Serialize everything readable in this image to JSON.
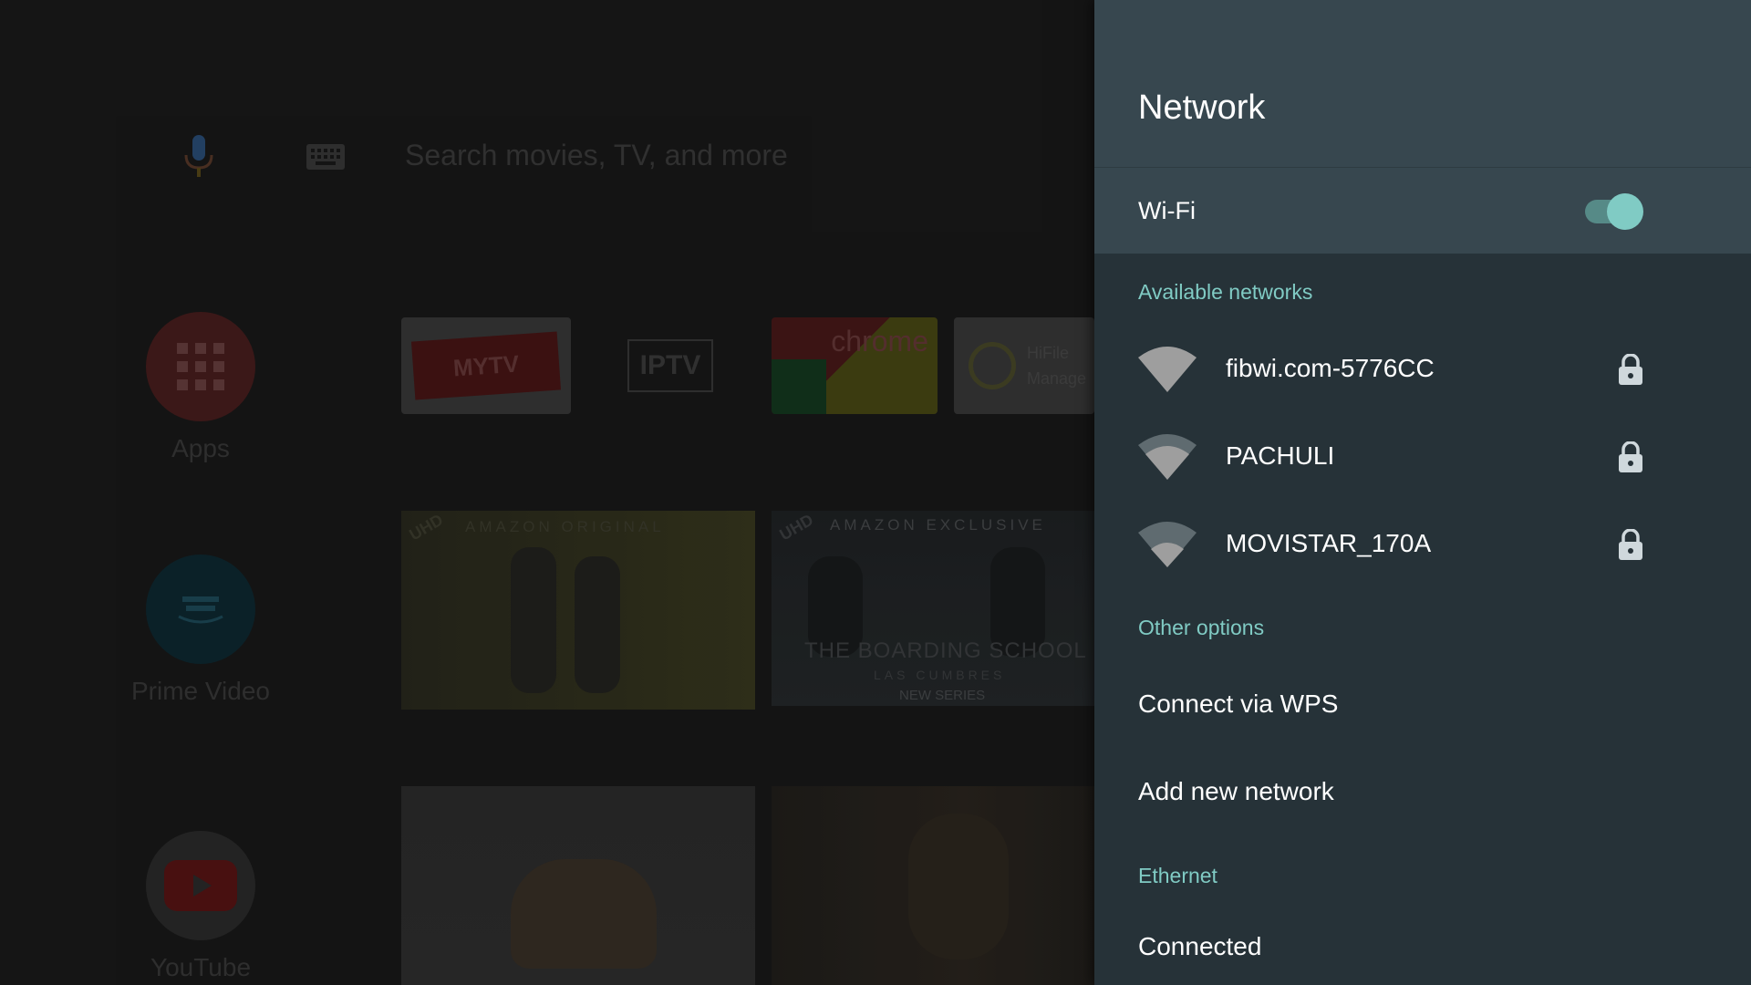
{
  "search": {
    "placeholder": "Search movies, TV, and more"
  },
  "home_nav": [
    {
      "label": "Apps"
    },
    {
      "label": "Prime Video"
    },
    {
      "label": "YouTube"
    }
  ],
  "favorite_apps": [
    {
      "name": "MYTV"
    },
    {
      "name": "IPTV"
    },
    {
      "name": "chrome"
    },
    {
      "name": "HiFile Manage"
    }
  ],
  "content_cards": [
    {
      "badge": "UHD",
      "overline": "AMAZON ORIGINAL",
      "caption": ""
    },
    {
      "badge": "UHD",
      "overline": "AMAZON EXCLUSIVE",
      "title": "THE BOARDING SCHOOL",
      "subtitle": "LAS CUMBRES",
      "caption": "NEW SERIES"
    }
  ],
  "network_panel": {
    "title": "Network",
    "wifi": {
      "label": "Wi-Fi",
      "enabled": true
    },
    "available_header": "Available networks",
    "networks": [
      {
        "ssid": "fibwi.com-5776CC",
        "secured": true,
        "icon": "wifi-icon"
      },
      {
        "ssid": "PACHULI",
        "secured": true,
        "icon": "wifi-icon"
      },
      {
        "ssid": "MOVISTAR_170A",
        "secured": true,
        "icon": "wifi-icon"
      }
    ],
    "other_header": "Other options",
    "options": [
      {
        "label": "Connect via WPS"
      },
      {
        "label": "Add new network"
      }
    ],
    "ethernet_header": "Ethernet",
    "ethernet_status": "Connected"
  },
  "colors": {
    "panel_bg": "#263238",
    "header_bg": "#37474f",
    "accent": "#80cbc4"
  }
}
